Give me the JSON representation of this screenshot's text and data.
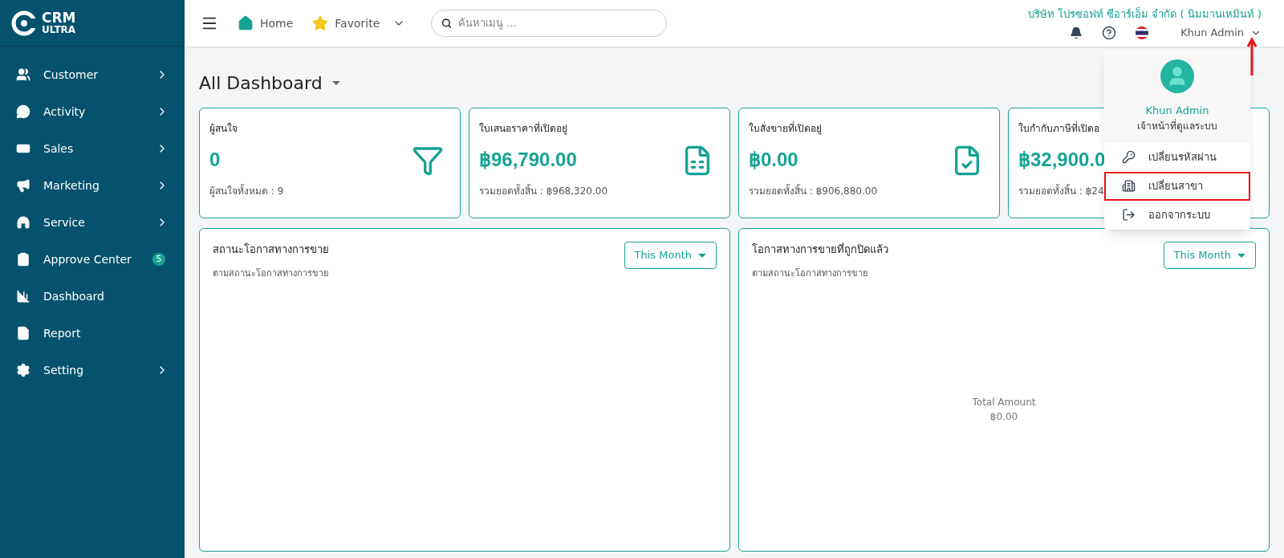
{
  "logo": {
    "line1": "CRM",
    "line2": "ULTRA"
  },
  "sidebar": {
    "items": [
      {
        "label": "Customer",
        "has_submenu": true
      },
      {
        "label": "Activity",
        "has_submenu": true
      },
      {
        "label": "Sales",
        "has_submenu": true
      },
      {
        "label": "Marketing",
        "has_submenu": true
      },
      {
        "label": "Service",
        "has_submenu": true
      },
      {
        "label": "Approve Center",
        "has_submenu": false,
        "badge": "5"
      },
      {
        "label": "Dashboard",
        "has_submenu": false
      },
      {
        "label": "Report",
        "has_submenu": false
      },
      {
        "label": "Setting",
        "has_submenu": true
      }
    ]
  },
  "topbar": {
    "home": "Home",
    "favorite": "Favorite",
    "search": {
      "placeholder": "ค้นหาเมนู ..."
    },
    "company": "บริษัท โปรซอฟท์ ซีอาร์เอ็ม จำกัด ( นิมมานเหมินท์ )",
    "user": "Khun Admin"
  },
  "page_title": "All Dashboard",
  "stat_cards": [
    {
      "title": "ผู้สนใจ",
      "value": "0",
      "footer": "ผู้สนใจทั้งหมด : 9"
    },
    {
      "title": "ใบเสนอราคาที่เปิดอยู่",
      "value": "฿96,790.00",
      "footer": "รวมยอดทั้งสิ้น : ฿968,320.00"
    },
    {
      "title": "ใบสั่งขายที่เปิดอยู่",
      "value": "฿0.00",
      "footer": "รวมยอดทั้งสิ้น : ฿906,880.00"
    },
    {
      "title": "ใบกำกับภาษีที่เปิดอ",
      "value": "฿32,900.0",
      "footer": "รวมยอดทั้งสิ้น : ฿24"
    }
  ],
  "panels": [
    {
      "title": "สถานะโอกาสทางการขาย",
      "subtitle": "ตามสถานะโอกาสทางการขาย",
      "period": "This Month"
    },
    {
      "title": "โอกาสทางการขายที่ถูกปิดแล้ว",
      "subtitle": "ตามสถานะโอกาสทางการขาย",
      "period": "This Month",
      "total_label": "Total Amount",
      "total_value": "฿0.00"
    }
  ],
  "user_menu": {
    "name": "Khun Admin",
    "role": "เจ้าหน้าที่ดูแลระบบ",
    "items": [
      {
        "label": "เปลี่ยนรหัสผ่าน",
        "highlighted": false
      },
      {
        "label": "เปลี่ยนสาขา",
        "highlighted": true
      },
      {
        "label": "ออกจากระบบ",
        "highlighted": false
      }
    ]
  }
}
